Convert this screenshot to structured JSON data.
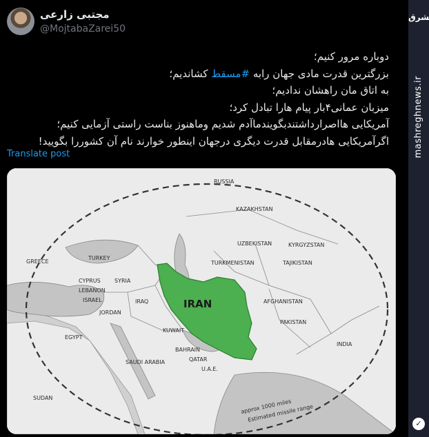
{
  "user": {
    "display_name": "مجتبی زارعی",
    "handle": "@MojtabaZarei50"
  },
  "post": {
    "lines": [
      {
        "text": "دوباره مرور کنیم؛"
      },
      {
        "pre": "بزرگترین قدرت مادی جهان رابه ",
        "hashtag": "#مسقط",
        "post": " کشاندیم؛"
      },
      {
        "text": "به اتاق مان راهشان ندادیم؛"
      },
      {
        "text": "میزبان عمانی۴بار پیام هارا تبادل کرد؛"
      },
      {
        "text": "آمریکایی هااصرارداشتندبگویندماآدم شدیم وماهنوز بناست راستی آزمایی کنیم؛"
      },
      {
        "text": "اگرآمریکایی هادرمقابل قدرت دیگری درجهان اینطور خوارند نام آن کشوررا بگویید!"
      }
    ],
    "translate_label": "Translate post"
  },
  "map": {
    "iran_label": "IRAN",
    "labels": [
      "RUSSIA",
      "KAZAKHSTAN",
      "UZBEKISTAN",
      "KYRGYZSTAN",
      "TURKMENISTAN",
      "TAJIKISTAN",
      "TURKEY",
      "GREECE",
      "CYPRUS",
      "LEBANON",
      "SYRIA",
      "ISRAEL",
      "IRAQ",
      "JORDAN",
      "EGYPT",
      "SAUDI ARABIA",
      "KUWAIT",
      "BAHRAIN",
      "QATAR",
      "U.A.E.",
      "AFGHANISTAN",
      "PAKISTAN",
      "INDIA",
      "SUDAN"
    ],
    "range_caption": "approx 1000 miles",
    "range_caption_2": "Estimated missile range",
    "iran_color": "#4caf50",
    "land_color": "#e6e6e6",
    "sea_color": "#c8c8c8"
  },
  "rail": {
    "logo": "مشرق",
    "site": "mashreghnews.ir"
  },
  "colors": {
    "background": "#000000",
    "accent": "#1d9bf0",
    "rail": "#1e2230"
  }
}
